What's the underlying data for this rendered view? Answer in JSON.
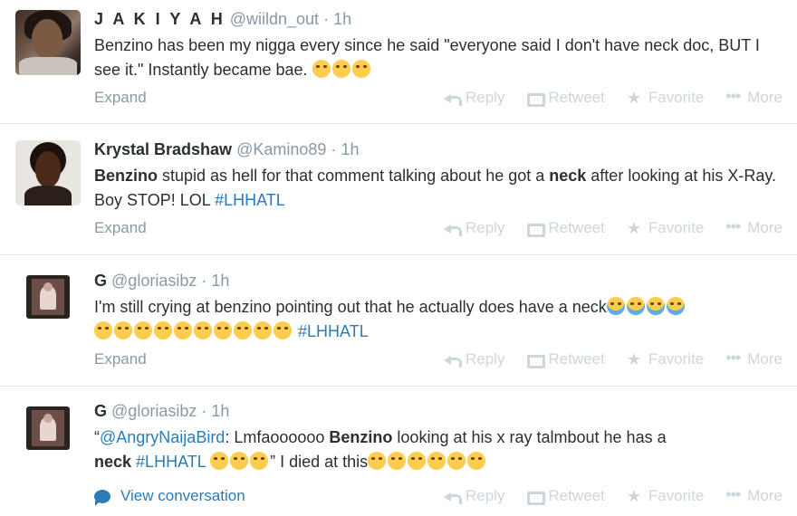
{
  "tweets": [
    {
      "name": "J A K I Y A H",
      "handle": "@wiildn_out",
      "time": "1h",
      "text_pre": "Benzino has been my nigga every since he said \"everyone said I don't have neck doc, BUT I see it.\" Instantly became bae. ",
      "footer_link": "Expand"
    },
    {
      "name": "Krystal Bradshaw",
      "handle": "@Kamino89",
      "time": "1h",
      "bold1": "Benzino",
      "text_mid1": " stupid as hell for that comment talking about he got a ",
      "bold2": "neck",
      "text_mid2": " after looking at his X-Ray. Boy STOP! LOL ",
      "hashtag": "#LHHATL",
      "footer_link": "Expand"
    },
    {
      "name": "G",
      "handle": "@gloriasibz",
      "time": "1h",
      "text_pre": "I'm still crying at benzino pointing out that he actually does have a neck",
      "hashtag": "#LHHATL",
      "footer_link": "Expand"
    },
    {
      "name": "G",
      "handle": "@gloriasibz",
      "time": "1h",
      "quote_open": "“",
      "mention": "@AngryNaijaBird",
      "text_mid1": ": Lmfaoooooo ",
      "bold1": "Benzino",
      "text_mid2": " looking at his x ray talmbout he has a ",
      "bold2": "neck",
      "hashtag": "#LHHATL",
      "text_end": "” I died at this",
      "footer_link": "View conversation"
    }
  ],
  "actions": {
    "reply": "Reply",
    "retweet": "Retweet",
    "favorite": "Favorite",
    "more": "More"
  },
  "separator": "·",
  "icons": [
    "reply-icon",
    "retweet-icon",
    "star-icon",
    "more-dots-icon",
    "speech-bubble-icon"
  ],
  "colors": {
    "text": "#292f33",
    "muted": "#8899a6",
    "link": "#2b7bb9",
    "action": "#ccd6dd",
    "divider": "#e1e8ed"
  }
}
